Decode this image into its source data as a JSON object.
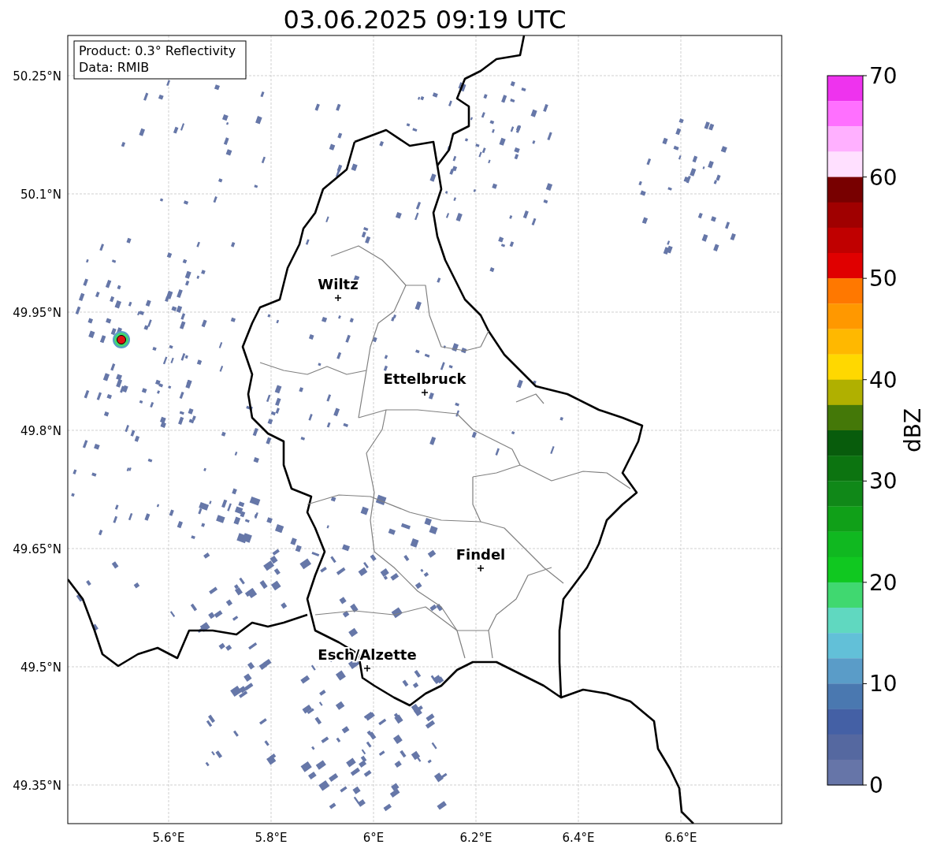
{
  "title": "03.06.2025 09:19 UTC",
  "info_box": [
    "Product: 0.3° Reflectivity",
    "Data: RMIB"
  ],
  "map": {
    "lon_labels": [
      "5.6°E",
      "5.8°E",
      "6°E",
      "6.2°E",
      "6.4°E",
      "6.6°E"
    ],
    "lat_labels": [
      "50.25°N",
      "50.1°N",
      "49.95°N",
      "49.8°N",
      "49.65°N",
      "49.5°N",
      "49.35°N"
    ],
    "places": [
      {
        "kind": "city",
        "name": "Wiltz"
      },
      {
        "kind": "city",
        "name": "Ettelbruck"
      },
      {
        "kind": "city",
        "name": "Findel"
      },
      {
        "kind": "city",
        "name": "Esch/Alzette"
      },
      {
        "kind": "radar"
      }
    ]
  },
  "colorbar": {
    "label": "dBZ",
    "ticks": [
      "70",
      "60",
      "50",
      "40",
      "30",
      "20",
      "10",
      "0"
    ],
    "bands": [
      {
        "color": "#ee33ee"
      },
      {
        "color": "#ff70ff"
      },
      {
        "color": "#ffb0ff"
      },
      {
        "color": "#ffe0ff"
      },
      {
        "color": "#780000"
      },
      {
        "color": "#a00000"
      },
      {
        "color": "#c00000"
      },
      {
        "color": "#e00000"
      },
      {
        "color": "#ff7800"
      },
      {
        "color": "#ff9800"
      },
      {
        "color": "#ffb800"
      },
      {
        "color": "#ffd800"
      },
      {
        "color": "#b0b000"
      },
      {
        "color": "#447808"
      },
      {
        "color": "#085c0c"
      },
      {
        "color": "#0c7410"
      },
      {
        "color": "#108818"
      },
      {
        "color": "#10a018"
      },
      {
        "color": "#10b820"
      },
      {
        "color": "#10c820"
      },
      {
        "color": "#40d870"
      },
      {
        "color": "#60d8c0"
      },
      {
        "color": "#62c0d8"
      },
      {
        "color": "#5a9cc8"
      },
      {
        "color": "#4a78b0"
      },
      {
        "color": "#4460a5"
      },
      {
        "color": "#5568a0"
      },
      {
        "color": "#6675a8"
      }
    ]
  }
}
